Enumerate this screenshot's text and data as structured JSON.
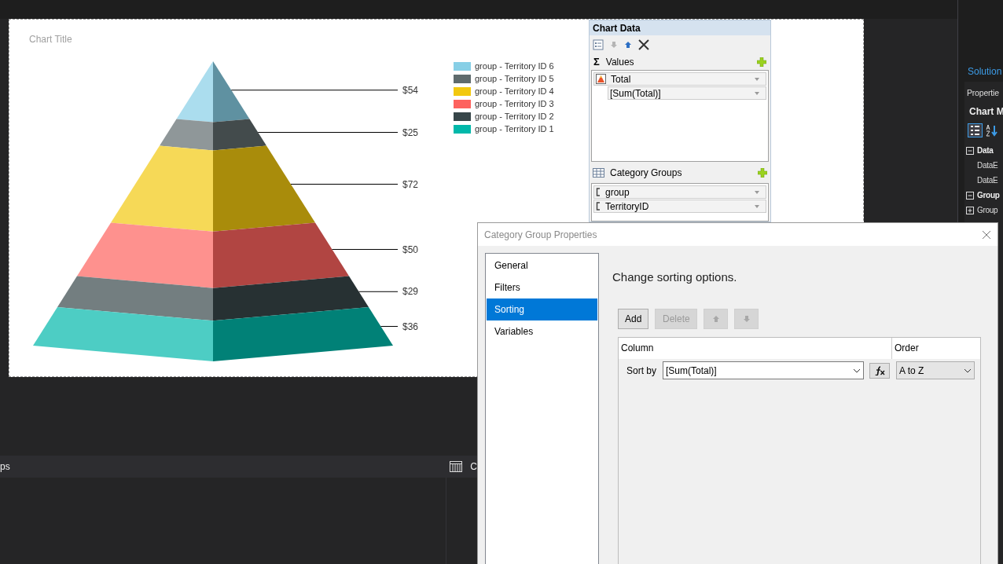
{
  "chart": {
    "chart_data": {
      "type": "other",
      "title": "Chart Title",
      "values": [
        54,
        25,
        72,
        50,
        29,
        36
      ],
      "value_labels": [
        "$54",
        "$25",
        "$72",
        "$50",
        "$29",
        "$36"
      ]
    },
    "legend": [
      {
        "label": "group - Territory ID 6",
        "color": "#87cfe6"
      },
      {
        "label": "group - Territory ID 5",
        "color": "#5f6b6d"
      },
      {
        "label": "group - Territory ID 4",
        "color": "#f2c80f"
      },
      {
        "label": "group - Territory ID 3",
        "color": "#fd625e"
      },
      {
        "label": "group - Territory ID 2",
        "color": "#374649"
      },
      {
        "label": "group - Territory ID 1",
        "color": "#01b8aa"
      }
    ]
  },
  "chart_data_pane": {
    "title": "Chart Data",
    "values_icon": "Σ",
    "values_header": "Values",
    "values": [
      {
        "name": "Total",
        "expression": "[Sum(Total)]"
      }
    ],
    "category_groups_header": "Category Groups",
    "category_groups": [
      "group",
      "TerritoryID"
    ]
  },
  "dialog": {
    "title": "Category Group Properties",
    "nav": [
      {
        "label": "General",
        "selected": false
      },
      {
        "label": "Filters",
        "selected": false
      },
      {
        "label": "Sorting",
        "selected": true
      },
      {
        "label": "Variables",
        "selected": false
      }
    ],
    "heading": "Change sorting options.",
    "buttons": [
      {
        "label": "Add",
        "disabled": false
      },
      {
        "label": "Delete",
        "disabled": true
      }
    ],
    "move_buttons": [
      {
        "kind": "up",
        "disabled": true
      },
      {
        "kind": "down",
        "disabled": true
      }
    ],
    "columns": [
      "Column",
      "Order"
    ],
    "sort_rows": [
      {
        "label": "Sort by",
        "column": "[Sum(Total)]",
        "order": "A to Z"
      }
    ]
  },
  "bottom_panel": {
    "title": "ps",
    "tab": "C"
  },
  "side_panel": {
    "solution_tab": "Solution",
    "properties_title": "Propertie",
    "object_name": "Chart M",
    "tree": [
      {
        "label": "Data",
        "expanded": true,
        "children": [
          {
            "label": "DataE"
          },
          {
            "label": "DataE"
          }
        ]
      },
      {
        "label": "Group",
        "expanded": true,
        "children": [
          {
            "label": "Group",
            "expanded": false
          }
        ]
      }
    ]
  }
}
